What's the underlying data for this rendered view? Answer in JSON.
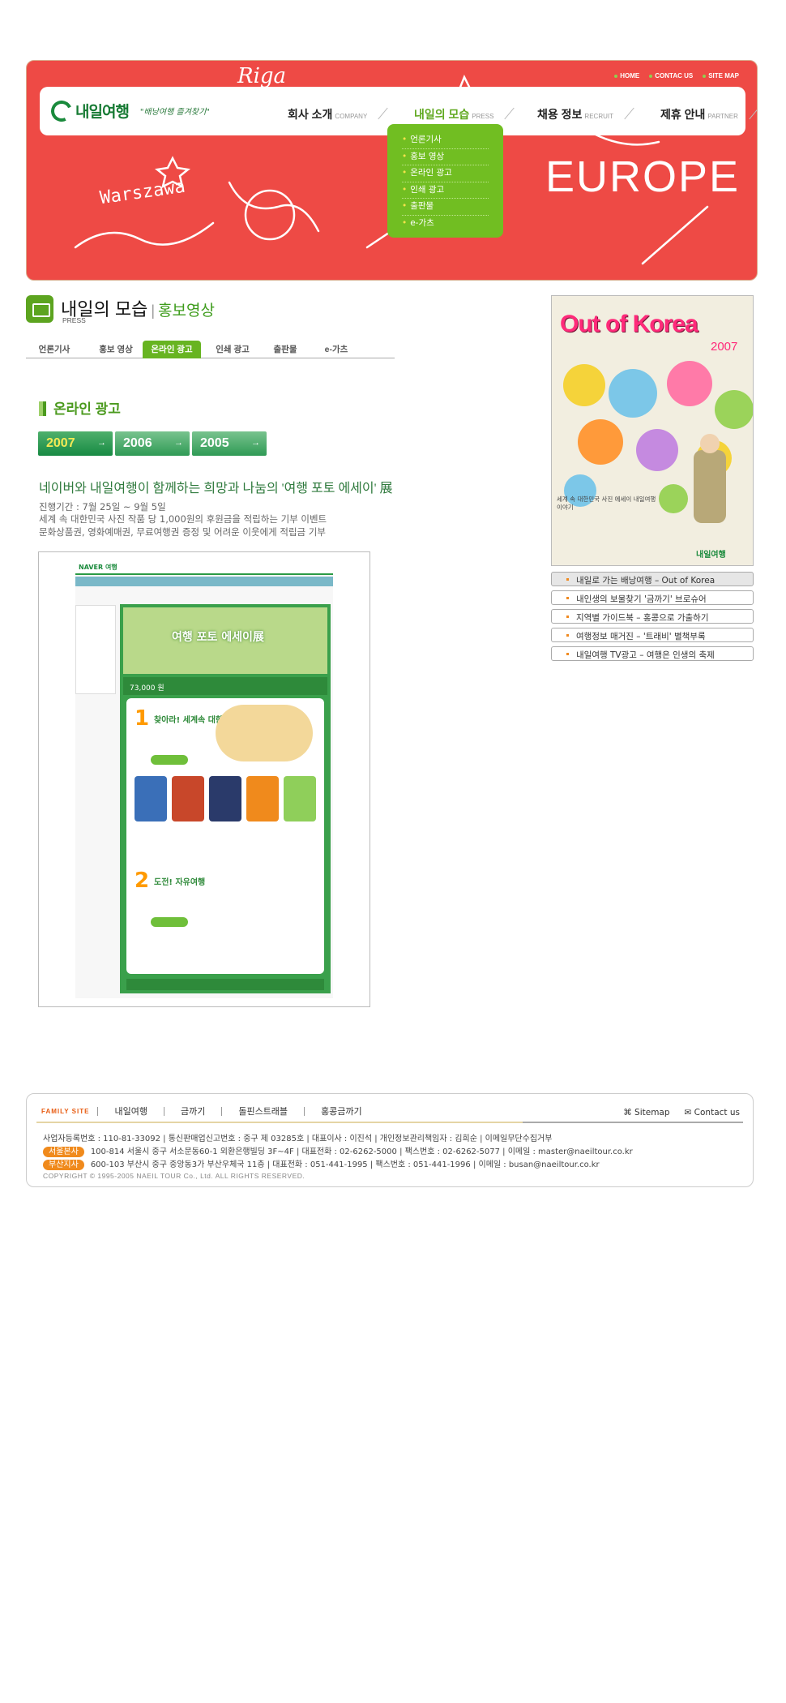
{
  "header": {
    "top_links": [
      "HOME",
      "CONTAC US",
      "SITE MAP"
    ],
    "logo_text": "내일여행",
    "slogan": "\"배낭여행 즐겨찾기\"",
    "banner_words": [
      "Riga",
      "Warszawa",
      "EUROPE"
    ],
    "menu": [
      {
        "label": "회사 소개",
        "en": "COMPANY"
      },
      {
        "label": "내일의 모습",
        "en": "PRESS"
      },
      {
        "label": "채용 정보",
        "en": "RECRUIT"
      },
      {
        "label": "제휴 안내",
        "en": "PARTNER"
      }
    ],
    "submenu": [
      "언론기사",
      "홍보 영상",
      "온라인 광고",
      "인쇄 광고",
      "출판물",
      "e-가츠"
    ]
  },
  "page": {
    "title": "내일의 모습",
    "separator": "|",
    "subtitle": "홍보영상",
    "title_en": "PRESS",
    "tabs": [
      "언론기사",
      "홍보 영상",
      "온라인 광고",
      "인쇄 광고",
      "출판물",
      "e-가츠"
    ],
    "section_heading": "온라인 광고",
    "years": [
      "2007",
      "2006",
      "2005"
    ],
    "headline": "네이버와 내일여행이 함께하는 희망과 나눔의 '여행 포토 에세이' 展",
    "period": "진행기간 : 7월 25일 ~ 9월 5일",
    "desc1": "세계 속 대한민국 사진 작품 당 1,000원의 후원금을 적립하는 기부 이벤트",
    "desc2": "문화상품권, 영화예매권, 무료여행권 증정 및 어려운 이웃에게 적립금 기부"
  },
  "screenshot": {
    "site_label": "NAVER 여행",
    "banner_title": "여행 포토 에세이展",
    "prize_text": "73,000 원",
    "step1": "찾아라! 세계속 대한민국",
    "step2": "도전! 자유여행"
  },
  "sidebar": {
    "ad_title": "Out of Korea",
    "ad_year": "2007",
    "ad_sub": "세계 속 대한민국 사진 에세이 내일여행 이야기",
    "ad_logo": "내일여행",
    "links": [
      "내일로 가는 배낭여행 – Out of Korea",
      "내인생의 보물찾기 '금까기' 브로슈어",
      "지역별 가이드북 – 홍콩으로 가출하기",
      "여행정보 매거진 – '트래비' 별책부록",
      "내일여행 TV광고 – 여행은 인생의 축제"
    ]
  },
  "footer": {
    "family_label": "FAMILY SITE",
    "family_sites": [
      "내일여행",
      "금까기",
      "돌핀스트래블",
      "홍콩금까기"
    ],
    "sitemap": "Sitemap",
    "contact": "Contact us",
    "biz_info": "사업자등록번호 : 110-81-33092 | 통신판매업신고번호 : 중구 제 03285호 | 대표이사 : 이진석 | 개인정보관리책임자 : 김희순 | 이메일무단수집거부",
    "seoul_badge": "서울본사",
    "seoul_info": "100-814 서울시 중구 서소문동60-1 외환은행빌딩 3F~4F | 대표전화 : 02-6262-5000 | 팩스번호 : 02-6262-5077 | 이메일 : master@naeiltour.co.kr",
    "busan_badge": "부산지사",
    "busan_info": "600-103 부산시 중구 중앙동3가 부산우체국 11층 | 대표전화 : 051-441-1995 | 팩스번호 : 051-441-1996 | 이메일 : busan@naeiltour.co.kr",
    "copyright": "COPYRIGHT © 1995-2005 NAEIL TOUR Co., Ltd. ALL RIGHTS RESERVED."
  }
}
